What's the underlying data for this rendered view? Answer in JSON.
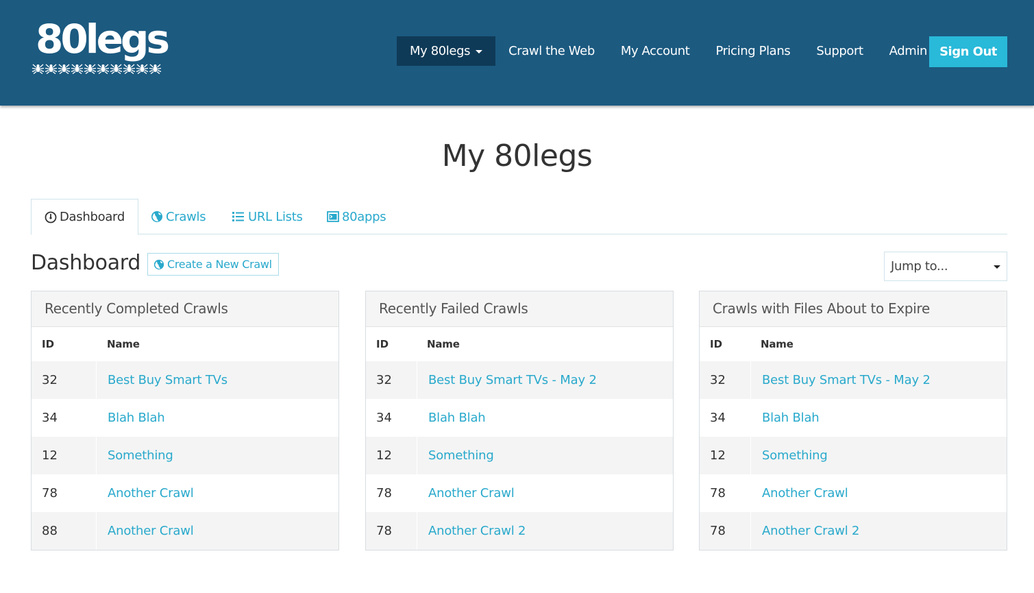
{
  "brand": {
    "logo_text": "80legs",
    "logo_icon": "spider-row-icon"
  },
  "nav": {
    "items": [
      {
        "label": "My 80legs",
        "dropdown": true,
        "active": true
      },
      {
        "label": "Crawl the Web"
      },
      {
        "label": "My Account"
      },
      {
        "label": "Pricing Plans"
      },
      {
        "label": "Support"
      },
      {
        "label": "Admin",
        "dropdown": true
      }
    ],
    "signout_label": "Sign Out"
  },
  "page": {
    "title": "My 80legs"
  },
  "tabs": [
    {
      "label": "Dashboard",
      "icon": "dashboard-icon",
      "active": true
    },
    {
      "label": "Crawls",
      "icon": "globe-icon"
    },
    {
      "label": "URL Lists",
      "icon": "list-icon"
    },
    {
      "label": "80apps",
      "icon": "app-window-icon"
    }
  ],
  "dashboard": {
    "heading": "Dashboard",
    "new_crawl_label": "Create a New Crawl",
    "jump_placeholder": "Jump to..."
  },
  "panels": [
    {
      "title": "Recently Completed Crawls",
      "columns": [
        "ID",
        "Name"
      ],
      "rows": [
        {
          "id": "32",
          "name": "Best Buy Smart TVs"
        },
        {
          "id": "34",
          "name": "Blah Blah"
        },
        {
          "id": "12",
          "name": "Something"
        },
        {
          "id": "78",
          "name": "Another Crawl"
        },
        {
          "id": "88",
          "name": "Another Crawl"
        }
      ]
    },
    {
      "title": "Recently Failed Crawls",
      "columns": [
        "ID",
        "Name"
      ],
      "rows": [
        {
          "id": "32",
          "name": "Best Buy Smart TVs - May 2"
        },
        {
          "id": "34",
          "name": "Blah Blah"
        },
        {
          "id": "12",
          "name": "Something"
        },
        {
          "id": "78",
          "name": "Another Crawl"
        },
        {
          "id": "78",
          "name": "Another Crawl 2"
        }
      ]
    },
    {
      "title": "Crawls with Files About to Expire",
      "columns": [
        "ID",
        "Name"
      ],
      "rows": [
        {
          "id": "32",
          "name": "Best Buy Smart TVs - May 2"
        },
        {
          "id": "34",
          "name": "Blah Blah"
        },
        {
          "id": "12",
          "name": "Something"
        },
        {
          "id": "78",
          "name": "Another Crawl"
        },
        {
          "id": "78",
          "name": "Another Crawl 2"
        }
      ]
    }
  ],
  "colors": {
    "header_bg": "#1c5a80",
    "active_nav_bg": "#0f3a57",
    "signout_bg": "#29b9d9",
    "link": "#29a9cc"
  }
}
